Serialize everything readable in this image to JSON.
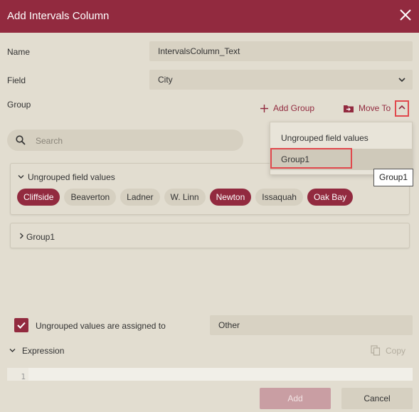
{
  "dialog": {
    "title": "Add Intervals Column"
  },
  "form": {
    "name_label": "Name",
    "name_value": "IntervalsColumn_Text",
    "field_label": "Field",
    "field_value": "City",
    "group_label": "Group"
  },
  "actions": {
    "add_group": "Add Group",
    "move_to": "Move To"
  },
  "search": {
    "placeholder": "Search"
  },
  "groups": [
    {
      "title": "Ungrouped field values",
      "chips": [
        {
          "label": "Cliffside",
          "selected": true
        },
        {
          "label": "Beaverton",
          "selected": false
        },
        {
          "label": "Ladner",
          "selected": false
        },
        {
          "label": "W. Linn",
          "selected": false
        },
        {
          "label": "Newton",
          "selected": true
        },
        {
          "label": "Issaquah",
          "selected": false
        },
        {
          "label": "Oak Bay",
          "selected": true
        }
      ]
    },
    {
      "title": "Group1"
    }
  ],
  "move_menu": {
    "items": [
      "Ungrouped field values",
      "Group1"
    ],
    "tooltip": "Group1"
  },
  "ungrouped": {
    "checkbox_label": "Ungrouped values are assigned to",
    "value": "Other"
  },
  "expression": {
    "label": "Expression",
    "copy_label": "Copy",
    "line_number": "1"
  },
  "footer": {
    "add_label": "Add",
    "cancel_label": "Cancel"
  },
  "colors": {
    "accent": "#922a3f",
    "background": "#e2ddd0",
    "field": "#d8d2c3",
    "highlight": "#e0484c"
  }
}
